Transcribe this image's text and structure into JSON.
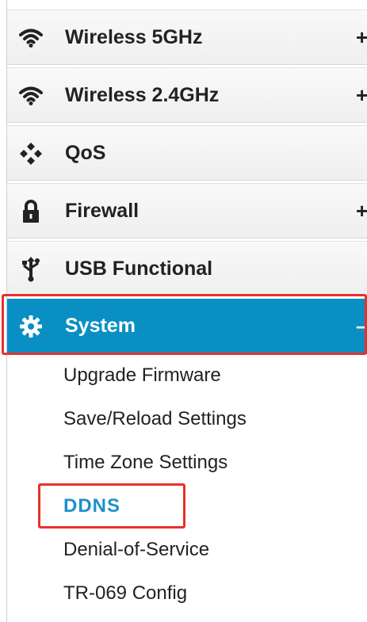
{
  "menu": {
    "items": [
      {
        "label": "Wireless 5GHz",
        "icon": "wifi-icon",
        "toggle": "+"
      },
      {
        "label": "Wireless 2.4GHz",
        "icon": "wifi-icon",
        "toggle": "+"
      },
      {
        "label": "QoS",
        "icon": "qos-diamond-icon",
        "toggle": ""
      },
      {
        "label": "Firewall",
        "icon": "lock-icon",
        "toggle": "+"
      },
      {
        "label": "USB Functional",
        "icon": "usb-icon",
        "toggle": ""
      },
      {
        "label": "System",
        "icon": "gear-icon",
        "toggle": "–",
        "active": true
      }
    ]
  },
  "submenu": {
    "items": [
      {
        "label": "Upgrade Firmware"
      },
      {
        "label": "Save/Reload Settings"
      },
      {
        "label": "Time Zone Settings"
      },
      {
        "label": "DDNS",
        "selected": true
      },
      {
        "label": "Denial-of-Service"
      },
      {
        "label": "TR-069 Config"
      }
    ]
  },
  "colors": {
    "active_bg": "#0a8fc4",
    "selected_text": "#1e90c8",
    "highlight_border": "#e8312b"
  }
}
